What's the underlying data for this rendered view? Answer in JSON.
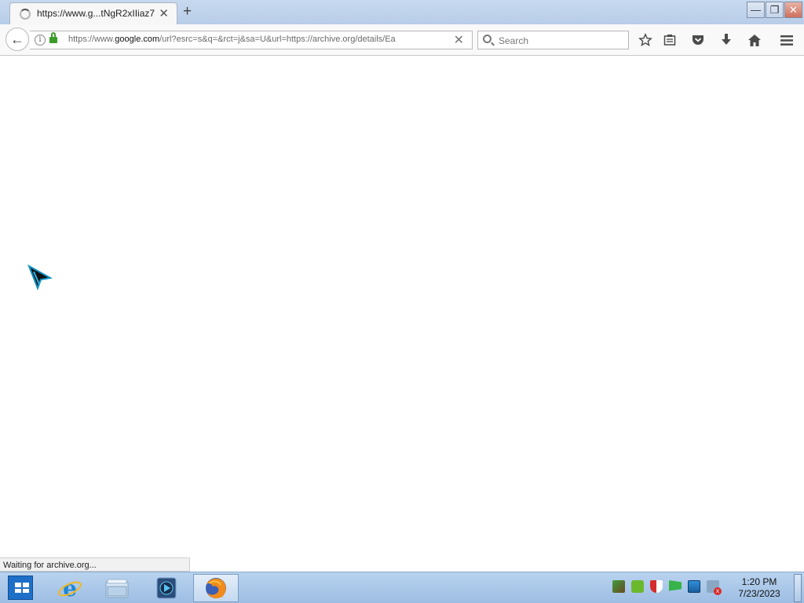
{
  "tab": {
    "title": "https://www.g...tNgR2xIIiaz7",
    "close_glyph": "✕",
    "new_tab_glyph": "+"
  },
  "window": {
    "minimize_glyph": "—",
    "restore_glyph": "❐",
    "close_glyph": "✕"
  },
  "navbar": {
    "back_glyph": "←",
    "url_prefix": "https://www.",
    "url_domain": "google.com",
    "url_rest": "/url?esrc=s&q=&rct=j&sa=U&url=https://archive.org/details/Ea",
    "url_clear_glyph": "✕",
    "search_placeholder": "Search"
  },
  "toolbar_icons": [
    "star-icon",
    "reading-list-icon",
    "pocket-icon",
    "download-icon",
    "home-icon",
    "menu-icon"
  ],
  "status_text": "Waiting for archive.org...",
  "taskbar": {
    "apps": [
      "internet-explorer-icon",
      "file-explorer-icon",
      "media-player-icon",
      "firefox-icon"
    ],
    "active_app": "firefox-icon"
  },
  "tray_icons": [
    "network-security-icon",
    "utorrent-icon",
    "shield-icon",
    "flag-icon",
    "network-icon",
    "volume-muted-icon"
  ],
  "clock": {
    "time": "1:20 PM",
    "date": "7/23/2023"
  },
  "colors": {
    "accent": "#1d6fc7",
    "lock_green": "#3a9b29",
    "taskbar": "#a9c7e8"
  }
}
